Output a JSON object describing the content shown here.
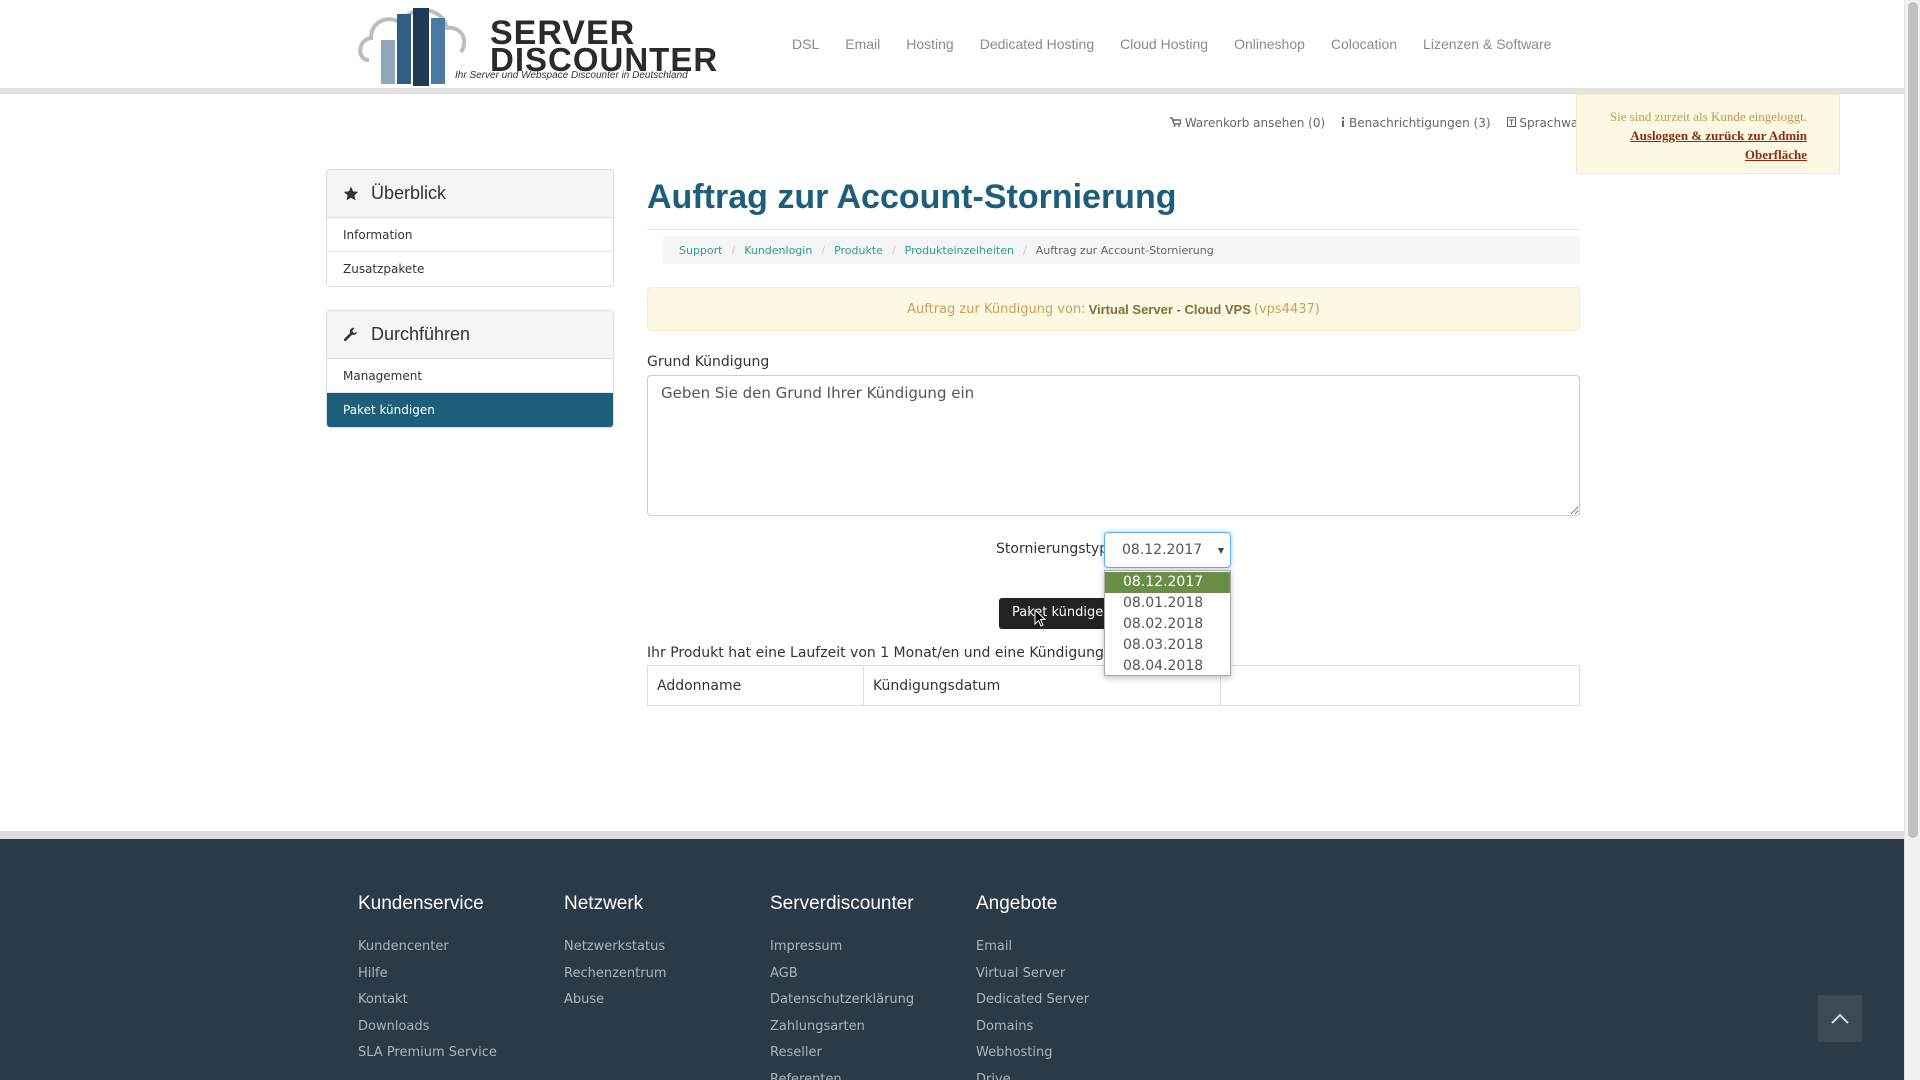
{
  "header": {
    "logo_line1": "SERVER",
    "logo_line2": "DISCOUNTER",
    "logo_tagline": "Ihr Server und Webspace Discounter in Deutschland",
    "nav": [
      "DSL",
      "Email",
      "Hosting",
      "Dedicated Hosting",
      "Cloud Hosting",
      "Onlineshop",
      "Colocation",
      "Lizenzen & Software"
    ]
  },
  "util": {
    "cart": "Warenkorb ansehen (0)",
    "notifications": "Benachrichtigungen (3)",
    "language": "Sprachwahl"
  },
  "admin_notice": {
    "text": "Sie sind zurzeit als Kunde eingeloggt.",
    "link": "Ausloggen & zurück zur Admin Oberfläche"
  },
  "sidebar": {
    "overview": {
      "title": "Überblick",
      "items": [
        "Information",
        "Zusatzpakete"
      ]
    },
    "actions": {
      "title": "Durchführen",
      "items": [
        "Management",
        "Paket kündigen"
      ],
      "active_index": 1
    }
  },
  "main": {
    "title": "Auftrag zur Account-Stornierung",
    "breadcrumb": [
      "Support",
      "Kundenlogin",
      "Produkte",
      "Produkteinzelheiten",
      "Auftrag zur Account-Stornierung"
    ],
    "alert_prefix": "Auftrag zur Kündigung von:",
    "alert_product": "Virtual Server - Cloud VPS",
    "alert_id": "(vps4437)",
    "reason_label": "Grund Kündigung",
    "reason_placeholder": "Geben Sie den Grund Ihrer Kündigung ein",
    "storno_label": "Stornierungstyp",
    "storno_selected": "08.12.2017",
    "storno_options": [
      "08.12.2017",
      "08.01.2018",
      "08.02.2018",
      "08.03.2018",
      "08.04.2018"
    ],
    "submit_label": "Paket kündigen",
    "term_text": "Ihr Produkt hat eine Laufzeit von 1 Monat/en und eine Kündigungsfrist",
    "table_headers": [
      "Addonname",
      "Kündigungsdatum",
      ""
    ]
  },
  "footer": {
    "columns": [
      {
        "title": "Kundenservice",
        "links": [
          "Kundencenter",
          "Hilfe",
          "Kontakt",
          "Downloads",
          "SLA Premium Service"
        ]
      },
      {
        "title": "Netzwerk",
        "links": [
          "Netzwerkstatus",
          "Rechenzentrum",
          "Abuse"
        ]
      },
      {
        "title": "Serverdiscounter",
        "links": [
          "Impressum",
          "AGB",
          "Datenschutzerklärung",
          "Zahlungsarten",
          "Reseller",
          "Referenten"
        ]
      },
      {
        "title": "Angebote",
        "links": [
          "Email",
          "Virtual Server",
          "Dedicated Server",
          "Domains",
          "Webhosting",
          "Drive"
        ]
      }
    ]
  },
  "colors": {
    "accent": "#1d5e7b",
    "link": "#2a9d8f",
    "footer_bg": "#2a3a46",
    "selected_option": "#6b8e47"
  },
  "icons": [
    "star-icon",
    "wrench-icon",
    "cart-icon",
    "info-icon",
    "language-icon",
    "chevron-up-icon",
    "mouse-cursor-icon"
  ]
}
